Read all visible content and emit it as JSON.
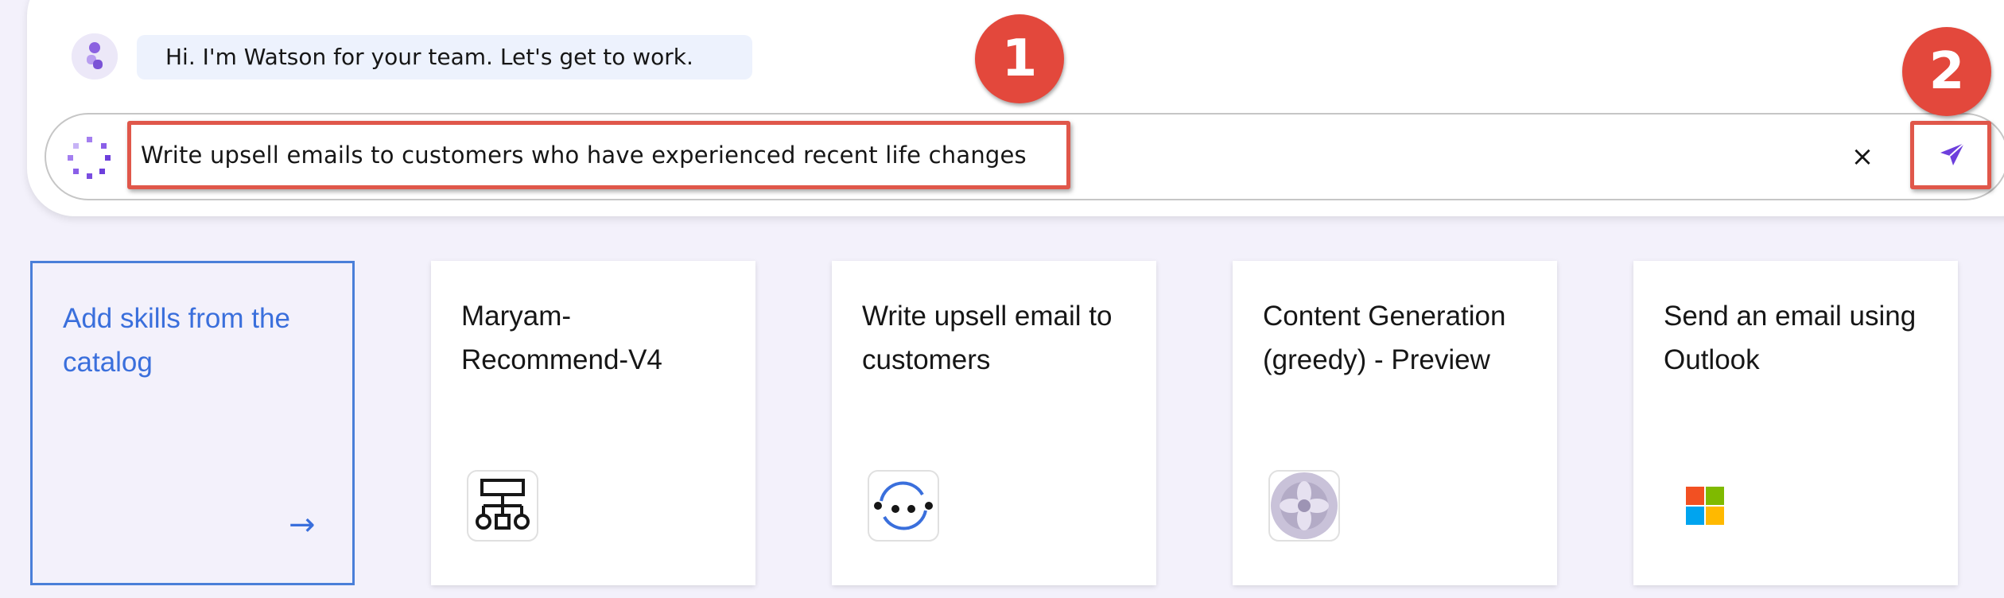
{
  "chat": {
    "greeting": "Hi. I'm Watson for your team. Let's get to work.",
    "prompt_value": "Write upsell emails to customers who have experienced recent life changes",
    "clear_label": "×",
    "send_icon": "send-icon"
  },
  "annotations": {
    "badge_1": "1",
    "badge_2": "2",
    "highlight_color": "#e0574a"
  },
  "skills": {
    "catalog_label": "Add skills from the catalog",
    "catalog_arrow": "→",
    "cards": [
      {
        "title": "Maryam-Recommend-V4",
        "icon": "workflow-hierarchy-icon"
      },
      {
        "title": "Write upsell email to customers",
        "icon": "sync-arrows-icon"
      },
      {
        "title": "Content Generation (greedy) - Preview",
        "icon": "flower-pattern-icon"
      },
      {
        "title": "Send an email using Outlook",
        "icon": "microsoft-logo-icon"
      }
    ]
  },
  "colors": {
    "accent": "#3a6fdc",
    "badge": "#e3483c",
    "background": "#f3f1fb"
  }
}
